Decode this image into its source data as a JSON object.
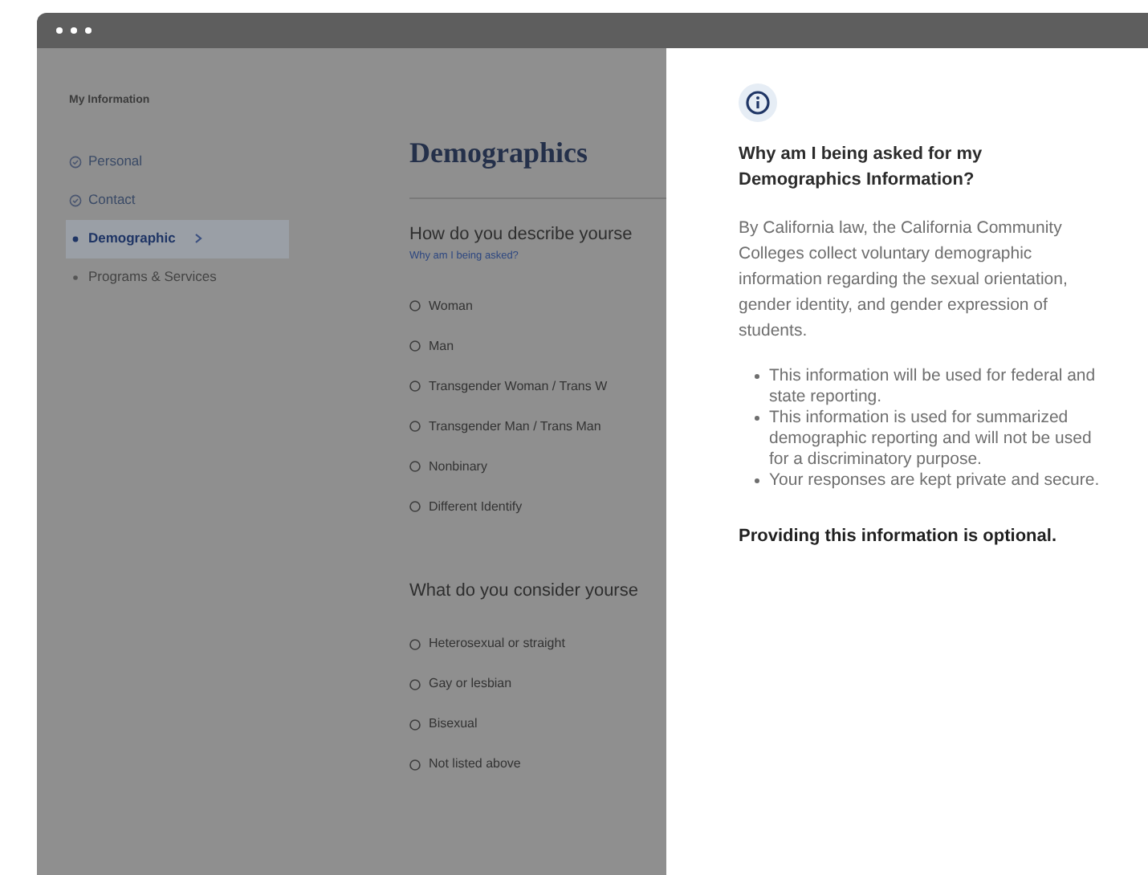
{
  "sidebar": {
    "title": "My Information",
    "items": [
      {
        "label": "Personal",
        "kind": "completed",
        "selected": false
      },
      {
        "label": "Contact",
        "kind": "completed",
        "selected": false
      },
      {
        "label": "Demographic",
        "kind": "current",
        "selected": true
      },
      {
        "label": "Programs & Services",
        "kind": "pending",
        "selected": false
      }
    ]
  },
  "main": {
    "title": "Demographics",
    "questions": [
      {
        "text": "How do you describe yourse",
        "link": "Why am I being asked?",
        "options": [
          {
            "label": "Woman",
            "selected": false
          },
          {
            "label": "Man",
            "selected": false
          },
          {
            "label": "Transgender Woman / Trans W",
            "selected": false
          },
          {
            "label": "Transgender Man / Trans Man",
            "selected": false
          },
          {
            "label": "Nonbinary",
            "selected": false
          },
          {
            "label": "Different Identify",
            "selected": false
          }
        ]
      },
      {
        "text": "What do you consider yourse",
        "options": [
          {
            "label": "Heterosexual or straight",
            "selected": false
          },
          {
            "label": "Gay or lesbian",
            "selected": false
          },
          {
            "label": "Bisexual",
            "selected": false
          },
          {
            "label": "Not listed above",
            "selected": false
          }
        ]
      }
    ]
  },
  "info_panel": {
    "heading": "Why am I being asked for my Demographics Information?",
    "body": "By California law, the California Community Colleges collect voluntary demographic information regarding the sexual orientation, gender identity, and gender expression of students.",
    "bullets": [
      "This information will be used for federal and state reporting.",
      "This information is used for summarized demographic reporting and will not be used for a discriminatory purpose.",
      "Your responses are kept private and secure."
    ],
    "footer": "Providing this information is optional."
  }
}
